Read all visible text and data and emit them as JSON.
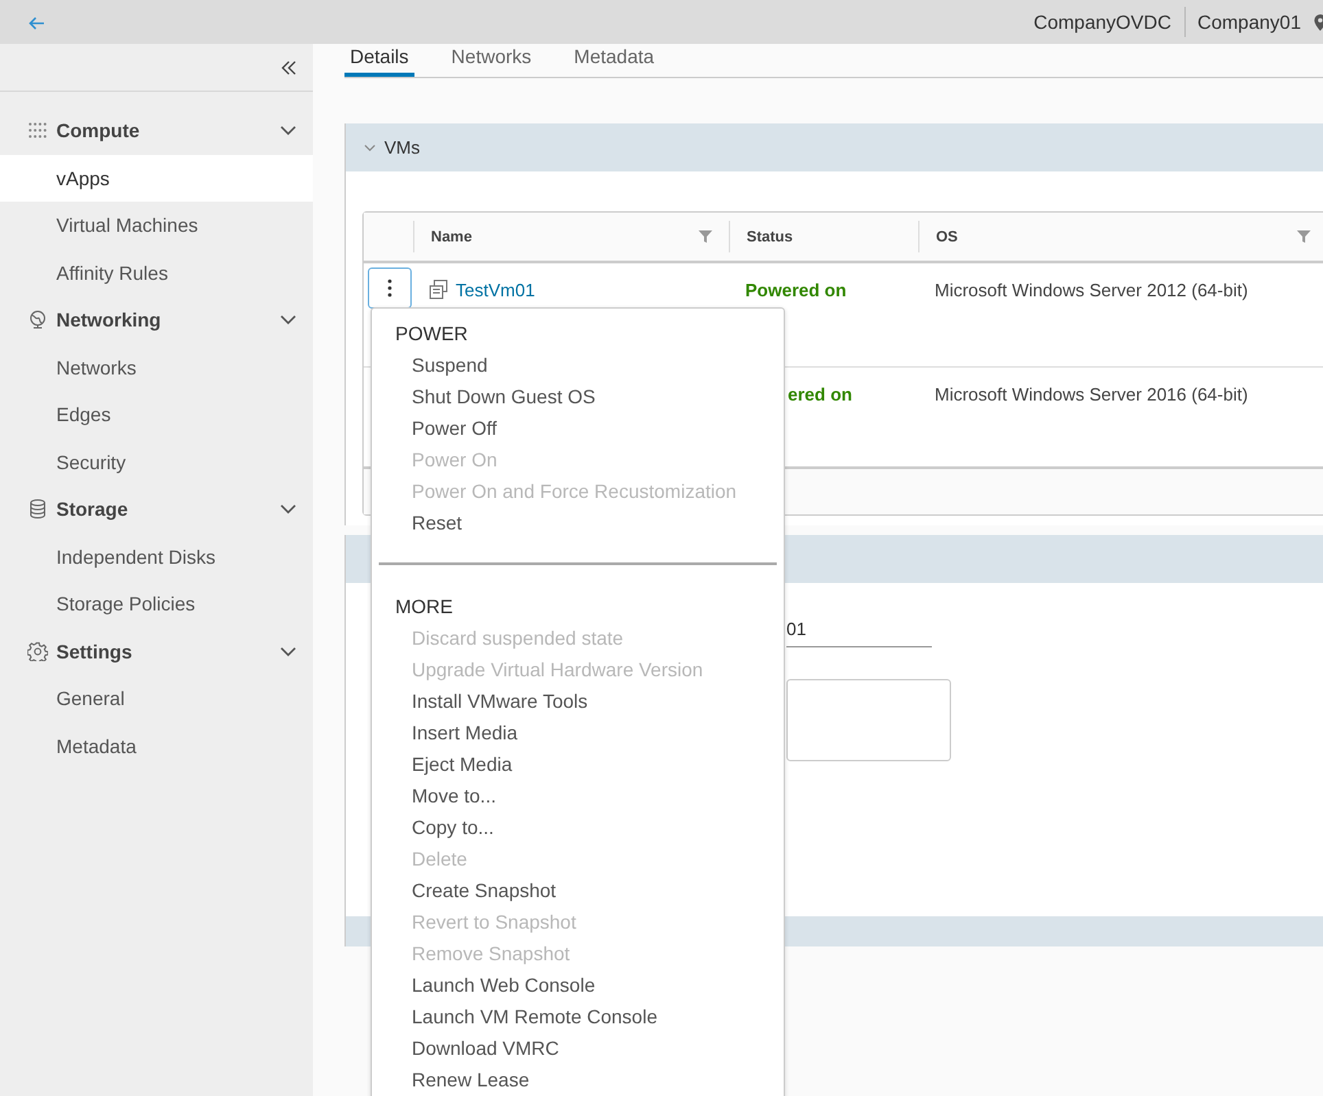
{
  "topbar": {
    "org_vdc": "CompanyOVDC",
    "org": "Company01"
  },
  "sidebar": {
    "groups": [
      {
        "title": "Compute",
        "kind": "grid",
        "expanded": true,
        "items": [
          {
            "label": "vApps",
            "selected": true
          },
          {
            "label": "Virtual Machines",
            "selected": false
          },
          {
            "label": "Affinity Rules",
            "selected": false
          }
        ]
      },
      {
        "title": "Networking",
        "kind": "globe",
        "expanded": true,
        "items": [
          {
            "label": "Networks",
            "selected": false
          },
          {
            "label": "Edges",
            "selected": false
          },
          {
            "label": "Security",
            "selected": false
          }
        ]
      },
      {
        "title": "Storage",
        "kind": "database",
        "expanded": true,
        "items": [
          {
            "label": "Independent Disks",
            "selected": false
          },
          {
            "label": "Storage Policies",
            "selected": false
          }
        ]
      },
      {
        "title": "Settings",
        "kind": "gear",
        "expanded": true,
        "items": [
          {
            "label": "General",
            "selected": false
          },
          {
            "label": "Metadata",
            "selected": false
          }
        ]
      }
    ]
  },
  "tabs": [
    {
      "label": "Details",
      "selected": true
    },
    {
      "label": "Networks",
      "selected": false
    },
    {
      "label": "Metadata",
      "selected": false
    }
  ],
  "vms_panel": {
    "title": "VMs",
    "expanded": true,
    "table": {
      "columns": [
        {
          "label": "Name",
          "filter": true
        },
        {
          "label": "Status",
          "filter": false
        },
        {
          "label": "OS",
          "filter": true
        }
      ],
      "rows": [
        {
          "menu_button": true,
          "name": "TestVm01",
          "status": "Powered on",
          "os": "Microsoft Windows Server 2012 (64-bit)"
        },
        {
          "menu_button": false,
          "status": "ered on",
          "os": "Microsoft Windows Server 2016 (64-bit)"
        }
      ]
    }
  },
  "general_panel": {
    "name_value": "01"
  },
  "context_menu": {
    "sections": [
      {
        "title": "POWER",
        "items": [
          {
            "label": "Suspend",
            "disabled": false
          },
          {
            "label": "Shut Down Guest OS",
            "disabled": false
          },
          {
            "label": "Power Off",
            "disabled": false
          },
          {
            "label": "Power On",
            "disabled": true
          },
          {
            "label": "Power On and Force Recustomization",
            "disabled": true
          },
          {
            "label": "Reset",
            "disabled": false
          }
        ]
      },
      {
        "title": "MORE",
        "items": [
          {
            "label": "Discard suspended state",
            "disabled": true
          },
          {
            "label": "Upgrade Virtual Hardware Version",
            "disabled": true
          },
          {
            "label": "Install VMware Tools",
            "disabled": false
          },
          {
            "label": "Insert Media",
            "disabled": false
          },
          {
            "label": "Eject Media",
            "disabled": false
          },
          {
            "label": "Move to...",
            "disabled": false
          },
          {
            "label": "Copy to...",
            "disabled": false
          },
          {
            "label": "Delete",
            "disabled": true
          },
          {
            "label": "Create Snapshot",
            "disabled": false
          },
          {
            "label": "Revert to Snapshot",
            "disabled": true
          },
          {
            "label": "Remove Snapshot",
            "disabled": true
          },
          {
            "label": "Launch Web Console",
            "disabled": false
          },
          {
            "label": "Launch VM Remote Console",
            "disabled": false
          },
          {
            "label": "Download VMRC",
            "disabled": false
          },
          {
            "label": "Renew Lease",
            "disabled": false
          }
        ]
      }
    ]
  }
}
